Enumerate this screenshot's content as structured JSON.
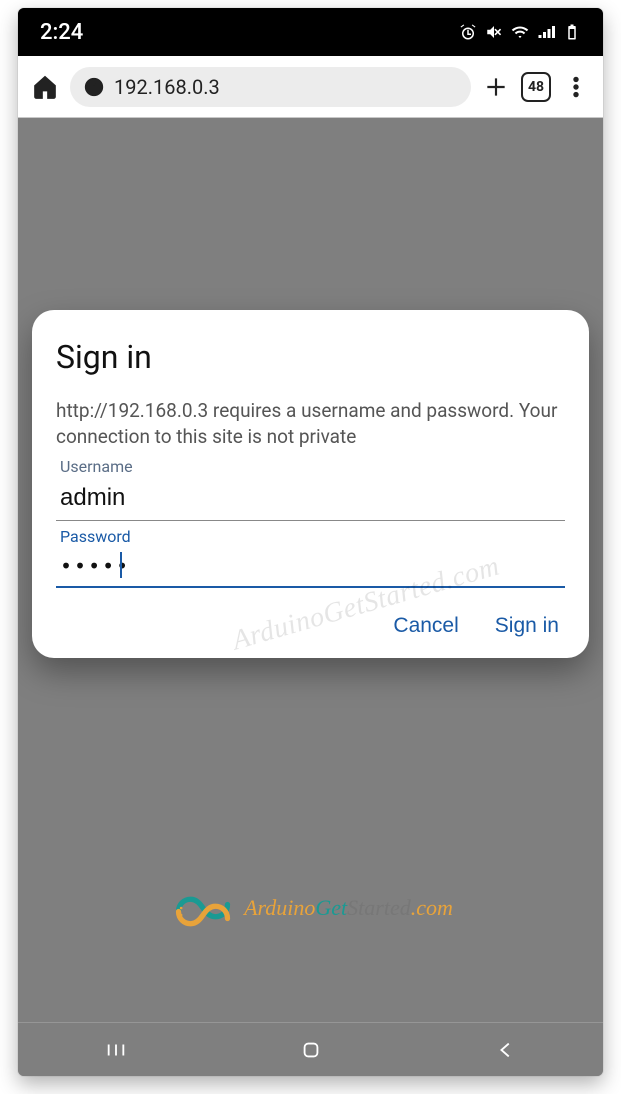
{
  "statusbar": {
    "time": "2:24"
  },
  "toolbar": {
    "url": "192.168.0.3",
    "tab_count": "48"
  },
  "dialog": {
    "title": "Sign in",
    "message": "http://192.168.0.3 requires a username and password. Your connection to this site is not private",
    "username_label": "Username",
    "username_value": "admin",
    "password_label": "Password",
    "password_value": "•••••",
    "cancel": "Cancel",
    "signin": "Sign in"
  },
  "watermark": "ArduinoGetStarted.com",
  "brand": {
    "p1": "Arduino",
    "p2": "Get",
    "p3": "Started",
    "p4": ".com"
  }
}
